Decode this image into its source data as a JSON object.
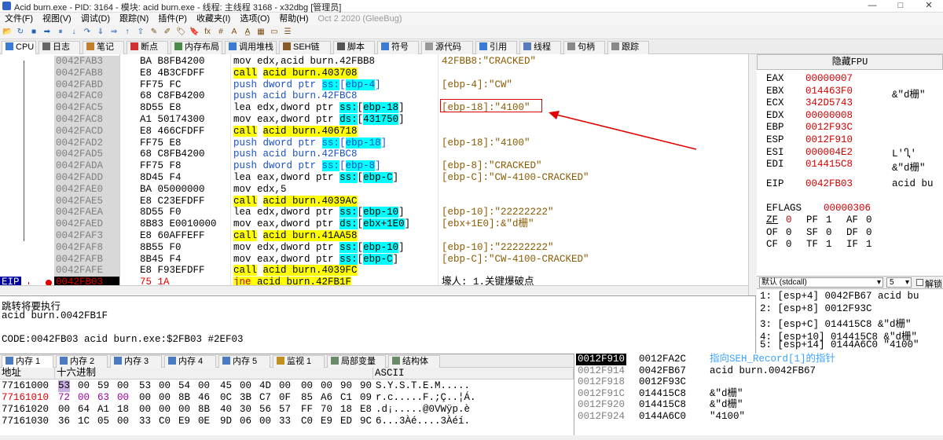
{
  "window": {
    "title": "Acid burn.exe - PID: 3164 - 模块: acid burn.exe - 线程: 主线程 3168 - x32dbg [管理员]",
    "minimize": "—",
    "maximize": "□",
    "close": "✕"
  },
  "menu": {
    "items": [
      "文件(F)",
      "视图(V)",
      "调试(D)",
      "跟踪(N)",
      "插件(P)",
      "收藏夹(I)",
      "选项(O)",
      "帮助(H)"
    ],
    "build": "Oct 2 2020 (GleeBug)"
  },
  "toolbar": {
    "icons": [
      "open-icon",
      "restart-icon",
      "stop-icon",
      "run-icon",
      "pause-icon",
      "step-into-icon",
      "step-over-icon",
      "trace-into-icon",
      "trace-over-icon",
      "execute-till-return-icon",
      "run-to-user-icon",
      "patch-icon",
      "comment-icon",
      "label-icon",
      "bookmark-icon",
      "function-icon",
      "hash-icon",
      "text-icon",
      "strings-icon",
      "calculator-icon",
      "memory-icon",
      "log-icon"
    ],
    "glyphs": [
      "📂",
      "↻",
      "■",
      "➡",
      "⏸",
      "↓",
      "↷",
      "⇓",
      "⇒",
      "↑",
      "⇧",
      "✎",
      "✐",
      "🏷",
      "🔖",
      "fx",
      "#",
      "A",
      "A̲",
      "▦",
      "▭",
      "☰"
    ]
  },
  "tabs": [
    {
      "label": "CPU",
      "icon": "cpu-icon"
    },
    {
      "label": "日志",
      "icon": "log-icon"
    },
    {
      "label": "笔记",
      "icon": "notes-icon"
    },
    {
      "label": "断点",
      "icon": "breakpoint-icon"
    },
    {
      "label": "内存布局",
      "icon": "memory-map-icon"
    },
    {
      "label": "调用堆栈",
      "icon": "callstack-icon"
    },
    {
      "label": "SEH链",
      "icon": "seh-icon"
    },
    {
      "label": "脚本",
      "icon": "script-icon"
    },
    {
      "label": "符号",
      "icon": "symbols-icon"
    },
    {
      "label": "源代码",
      "icon": "source-icon"
    },
    {
      "label": "引用",
      "icon": "references-icon"
    },
    {
      "label": "线程",
      "icon": "threads-icon"
    },
    {
      "label": "句柄",
      "icon": "handles-icon"
    },
    {
      "label": "跟踪",
      "icon": "trace-icon"
    }
  ],
  "disasm": [
    {
      "addr": "0042FAB3",
      "bytes": "BA B8FB4200",
      "op": "mov",
      "args": "edx,acid burn.42FBB8",
      "comment": "42FBB8:\"CRACKED\""
    },
    {
      "addr": "0042FAB8",
      "bytes": "E8 4B3CFDFF",
      "op": "call",
      "args": "acid burn.403708",
      "comment": ""
    },
    {
      "addr": "0042FABD",
      "bytes": "FF75 FC",
      "op": "push",
      "args": "dword ptr ss:[ebp-4]",
      "comment": "[ebp-4]:\"CW\""
    },
    {
      "addr": "0042FAC0",
      "bytes": "68 C8FB4200",
      "op": "push",
      "args": "acid burn.42FBC8",
      "comment": ""
    },
    {
      "addr": "0042FAC5",
      "bytes": "8D55 E8",
      "op": "lea",
      "args": "edx,dword ptr ss:[ebp-18]",
      "comment": "[ebp-18]:\"4100\""
    },
    {
      "addr": "0042FAC8",
      "bytes": "A1 50174300",
      "op": "mov",
      "args": "eax,dword ptr ds:[431750]",
      "comment": ""
    },
    {
      "addr": "0042FACD",
      "bytes": "E8 466CFDFF",
      "op": "call",
      "args": "acid burn.406718",
      "comment": ""
    },
    {
      "addr": "0042FAD2",
      "bytes": "FF75 E8",
      "op": "push",
      "args": "dword ptr ss:[ebp-18]",
      "comment": "[ebp-18]:\"4100\""
    },
    {
      "addr": "0042FAD5",
      "bytes": "68 C8FB4200",
      "op": "push",
      "args": "acid burn.42FBC8",
      "comment": ""
    },
    {
      "addr": "0042FADA",
      "bytes": "FF75 F8",
      "op": "push",
      "args": "dword ptr ss:[ebp-8]",
      "comment": "[ebp-8]:\"CRACKED\""
    },
    {
      "addr": "0042FADD",
      "bytes": "8D45 F4",
      "op": "lea",
      "args": "eax,dword ptr ss:[ebp-C]",
      "comment": "[ebp-C]:\"CW-4100-CRACKED\""
    },
    {
      "addr": "0042FAE0",
      "bytes": "BA 05000000",
      "op": "mov",
      "args": "edx,5",
      "comment": ""
    },
    {
      "addr": "0042FAE5",
      "bytes": "E8 C23EFDFF",
      "op": "call",
      "args": "acid burn.4039AC",
      "comment": ""
    },
    {
      "addr": "0042FAEA",
      "bytes": "8D55 F0",
      "op": "lea",
      "args": "edx,dword ptr ss:[ebp-10]",
      "comment": "[ebp-10]:\"22222222\""
    },
    {
      "addr": "0042FAED",
      "bytes": "8B83 E0010000",
      "op": "mov",
      "args": "eax,dword ptr ds:[ebx+1E0]",
      "comment": "[ebx+1E0]:&\"d栅\""
    },
    {
      "addr": "0042FAF3",
      "bytes": "E8 60AFFEFF",
      "op": "call",
      "args": "acid burn.41AA58",
      "comment": ""
    },
    {
      "addr": "0042FAF8",
      "bytes": "8B55 F0",
      "op": "mov",
      "args": "edx,dword ptr ss:[ebp-10]",
      "comment": "[ebp-10]:\"22222222\""
    },
    {
      "addr": "0042FAFB",
      "bytes": "8B45 F4",
      "op": "mov",
      "args": "eax,dword ptr ss:[ebp-C]",
      "comment": "[ebp-C]:\"CW-4100-CRACKED\""
    },
    {
      "addr": "0042FAFE",
      "bytes": "E8 F93EFDFF",
      "op": "call",
      "args": "acid burn.4039FC",
      "comment": ""
    }
  ],
  "eip_row": {
    "label": "EIP",
    "addr": "0042FB03",
    "bytes": "75 1A",
    "op": "jne",
    "args": "acid burn.42FB1F",
    "comment": "壕人: 1.关键爆破点"
  },
  "info": {
    "line1": "跳转将要执行",
    "line2": "acid burn.0042FB1F",
    "line3": "CODE:0042FB03 acid burn.exe:$2FB03 #2EF03"
  },
  "regs": {
    "header": "隐藏FPU",
    "items": [
      {
        "name": "EAX",
        "val": "00000007",
        "com": ""
      },
      {
        "name": "EBX",
        "val": "014463F0",
        "com": "&\"d栅\""
      },
      {
        "name": "ECX",
        "val": "342D5743",
        "com": ""
      },
      {
        "name": "EDX",
        "val": "00000008",
        "com": ""
      },
      {
        "name": "EBP",
        "val": "0012F93C",
        "com": ""
      },
      {
        "name": "ESP",
        "val": "0012F910",
        "com": ""
      },
      {
        "name": "ESI",
        "val": "000004E2",
        "com": "L'Ⴂ'"
      },
      {
        "name": "EDI",
        "val": "014415C8",
        "com": "&\"d栅\""
      }
    ],
    "eip": {
      "name": "EIP",
      "val": "0042FB03",
      "com": "acid bu"
    },
    "eflags": {
      "name": "EFLAGS",
      "val": "00000306"
    },
    "flags": [
      [
        "ZF",
        "0",
        "PF",
        "1",
        "AF",
        "0"
      ],
      [
        "OF",
        "0",
        "SF",
        "0",
        "DF",
        "0"
      ],
      [
        "CF",
        "0",
        "TF",
        "1",
        "IF",
        "1"
      ]
    ]
  },
  "stack_ctl": {
    "conv": "默认 (stdcall)",
    "count": "5",
    "unlock": "解锁"
  },
  "stack_args": [
    "1: [esp+4] 0042FB67 acid bu",
    "2: [esp+8] 0012F93C",
    "3: [esp+C] 014415C8 &\"d栅\"",
    "4: [esp+10] 014415C8 &\"d栅\"",
    "5: [esp+14] 0144A6C0 \"4100\""
  ],
  "bottom_tabs": [
    {
      "label": "内存 1",
      "icon": "memory-icon"
    },
    {
      "label": "内存 2",
      "icon": "memory-icon"
    },
    {
      "label": "内存 3",
      "icon": "memory-icon"
    },
    {
      "label": "内存 4",
      "icon": "memory-icon"
    },
    {
      "label": "内存 5",
      "icon": "memory-icon"
    },
    {
      "label": "监视 1",
      "icon": "watch-icon"
    },
    {
      "label": "局部变量",
      "icon": "locals-icon"
    },
    {
      "label": "结构体",
      "icon": "struct-icon"
    }
  ],
  "dump": {
    "h_addr": "地址",
    "h_hex": "十六进制",
    "h_ascii": "ASCII",
    "rows": [
      {
        "addr": "77161000",
        "hex": [
          "53",
          "00",
          "59",
          "00",
          "53",
          "00",
          "54",
          "00",
          "45",
          "00",
          "4D",
          "00",
          "00",
          "00",
          "90",
          "90"
        ],
        "ascii": "S.Y.S.T.E.M....."
      },
      {
        "addr": "77161010",
        "hex": [
          "72",
          "00",
          "63",
          "00",
          "00",
          "00",
          "8B",
          "46",
          "0C",
          "3B",
          "C7",
          "0F",
          "85",
          "A6",
          "C1",
          "09"
        ],
        "ascii": "r.c.....F.;Ç..¦Á."
      },
      {
        "addr": "77161020",
        "hex": [
          "00",
          "64",
          "A1",
          "18",
          "00",
          "00",
          "00",
          "8B",
          "40",
          "30",
          "56",
          "57",
          "FF",
          "70",
          "18",
          "E8"
        ],
        "ascii": ".d¡.....@0VWÿp.è"
      },
      {
        "addr": "77161030",
        "hex": [
          "36",
          "1C",
          "05",
          "00",
          "33",
          "C0",
          "E9",
          "0E",
          "9D",
          "06",
          "00",
          "33",
          "C0",
          "E9",
          "ED",
          "9C"
        ],
        "ascii": "6...3Àé....3Àéí."
      }
    ]
  },
  "stack": [
    {
      "addr": "0012F910",
      "val": "0012FA2C",
      "com": "指向SEH_Record[1]的指针"
    },
    {
      "addr": "0012F914",
      "val": "0042FB67",
      "com": "acid burn.0042FB67"
    },
    {
      "addr": "0012F918",
      "val": "0012F93C",
      "com": ""
    },
    {
      "addr": "0012F91C",
      "val": "014415C8",
      "com": "&\"d栅\""
    },
    {
      "addr": "0012F920",
      "val": "014415C8",
      "com": "&\"d栅\""
    },
    {
      "addr": "0012F924",
      "val": "0144A6C0",
      "com": "\"4100\""
    }
  ],
  "colors": {
    "accent_red": "#e00000",
    "call_yellow": "#ffff00",
    "seg_cyan": "#00ffff",
    "eip_blue": "#0000a0",
    "reg_red": "#d00000"
  }
}
